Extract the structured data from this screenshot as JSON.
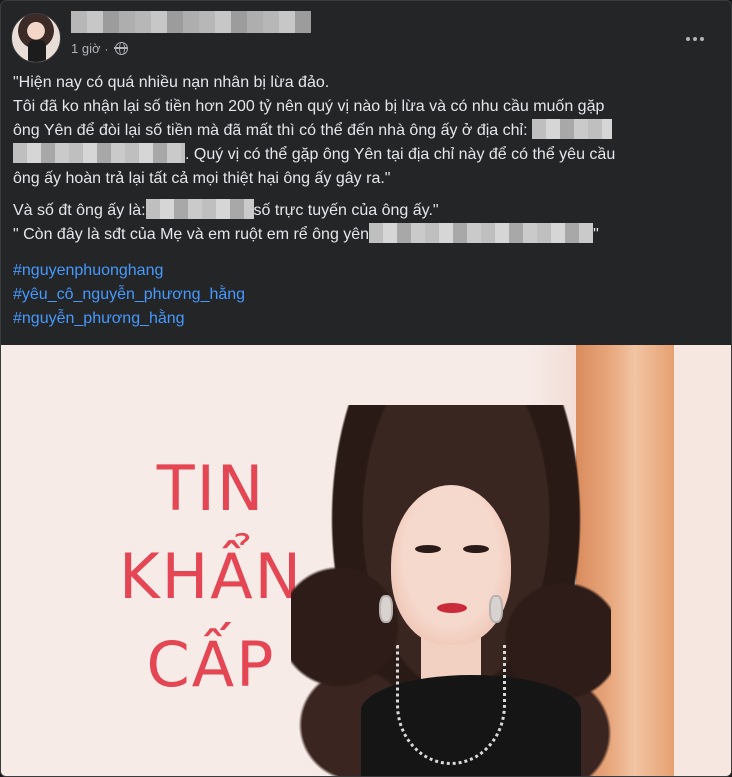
{
  "post": {
    "time": "1 giờ",
    "separator": "·",
    "lines": {
      "l1": "\"Hiện nay có quá nhiều nạn nhân bị lừa đảo.",
      "l2": "Tôi đã ko nhận lại số tiền hơn 200 tỷ nên quý vị nào bị lừa và có nhu cầu muốn gặp",
      "l3": "ông Yên để đòi lại số tiền mà đã mất thì có thể đến nhà ông ấy ở địa chỉ:",
      "l4": ". Quý vị có thể gặp ông Yên tại địa chỉ này để có thể yêu cầu",
      "l5": "ông ấy hoàn trả lại tất cả mọi thiệt hại ông ấy gây ra.\"",
      "l6a": "Và số đt ông ấy là:",
      "l6b": "số trực tuyến của ông ấy.\"",
      "l7a": "\" Còn đây là sđt của Mẹ và em ruột em rể ông yên",
      "l7b": "\""
    },
    "hashtags": [
      "#nguyenphuonghang",
      "#yêu_cô_nguyễn_phương_hằng",
      "#nguyễn_phương_hằng"
    ]
  },
  "image": {
    "headline": [
      "TIN",
      "KHẨN",
      "CẤP"
    ],
    "headline_color": "#e44653"
  },
  "icons": {
    "audience": "globe-icon",
    "menu": "more-horizontal-icon"
  }
}
